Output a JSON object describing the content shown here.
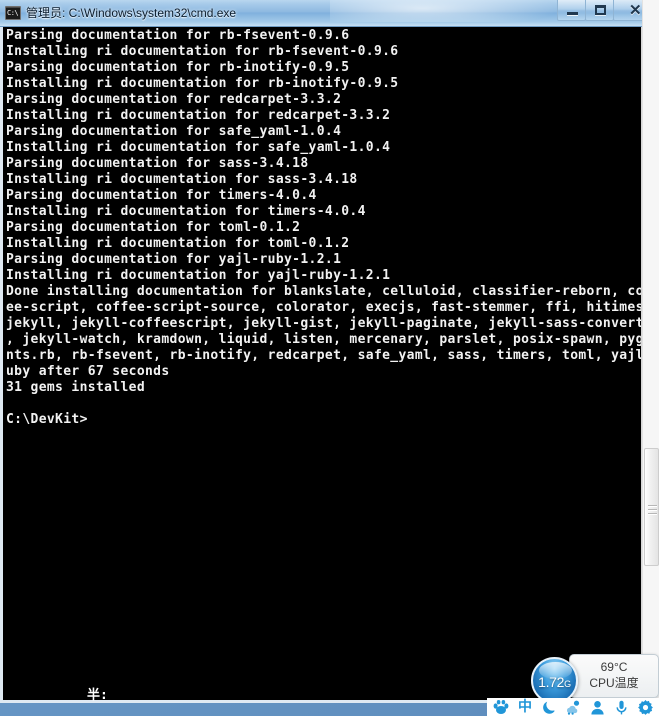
{
  "window": {
    "title": "管理员: C:\\Windows\\system32\\cmd.exe",
    "icon_name": "cmd-icon",
    "buttons": {
      "minimize": "Minimize",
      "maximize": "Maximize",
      "close": "Close"
    }
  },
  "console": {
    "prompt": "C:\\DevKit>",
    "ime_echo": "半:",
    "lines": [
      "Parsing documentation for rb-fsevent-0.9.6",
      "Installing ri documentation for rb-fsevent-0.9.6",
      "Parsing documentation for rb-inotify-0.9.5",
      "Installing ri documentation for rb-inotify-0.9.5",
      "Parsing documentation for redcarpet-3.3.2",
      "Installing ri documentation for redcarpet-3.3.2",
      "Parsing documentation for safe_yaml-1.0.4",
      "Installing ri documentation for safe_yaml-1.0.4",
      "Parsing documentation for sass-3.4.18",
      "Installing ri documentation for sass-3.4.18",
      "Parsing documentation for timers-4.0.4",
      "Installing ri documentation for timers-4.0.4",
      "Parsing documentation for toml-0.1.2",
      "Installing ri documentation for toml-0.1.2",
      "Parsing documentation for yajl-ruby-1.2.1",
      "Installing ri documentation for yajl-ruby-1.2.1",
      "Done installing documentation for blankslate, celluloid, classifier-reborn, coff",
      "ee-script, coffee-script-source, colorator, execjs, fast-stemmer, ffi, hitimes,",
      "jekyll, jekyll-coffeescript, jekyll-gist, jekyll-paginate, jekyll-sass-converter",
      ", jekyll-watch, kramdown, liquid, listen, mercenary, parslet, posix-spawn, pygme",
      "nts.rb, rb-fsevent, rb-inotify, redcarpet, safe_yaml, sass, timers, toml, yajl-r",
      "uby after 67 seconds",
      "31 gems installed",
      "",
      "C:\\DevKit>"
    ]
  },
  "console_scrollbar": {
    "up_arrow": "scroll-up",
    "down_arrow": "scroll-down",
    "thumb": "scroll-thumb"
  },
  "outer_scrollbar": {
    "thumb": "page-scroll-thumb"
  },
  "cpu_gadget": {
    "orb_value": "1.72",
    "orb_unit": "G",
    "temperature": "69°C",
    "label": "CPU温度"
  },
  "ime": {
    "items": [
      {
        "name": "sogou-logo-icon",
        "glyph": "paw"
      },
      {
        "name": "input-mode-chinese-icon",
        "glyph": "中"
      },
      {
        "name": "moon-icon",
        "glyph": "moon"
      },
      {
        "name": "weather-icon",
        "glyph": "weather"
      },
      {
        "name": "user-icon",
        "glyph": "user"
      },
      {
        "name": "microphone-icon",
        "glyph": "mic"
      },
      {
        "name": "settings-icon",
        "glyph": "gear"
      }
    ]
  },
  "colors": {
    "console_bg": "#000000",
    "console_fg": "#f2f2f2",
    "titlebar": "#8cb8e0",
    "accent": "#2196d8",
    "orb": "#1b6fb5"
  }
}
